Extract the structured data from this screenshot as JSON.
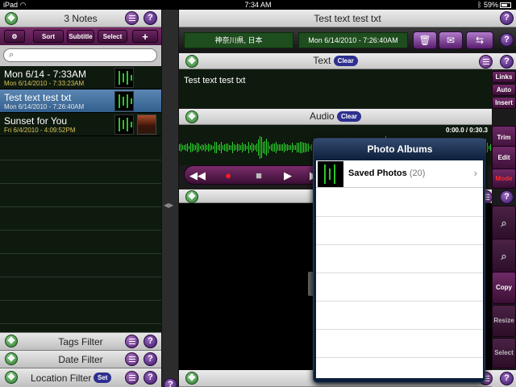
{
  "status_bar": {
    "device": "iPad",
    "time": "7:34 AM",
    "battery": "59%"
  },
  "left": {
    "header_title": "3 Notes",
    "toolbar": {
      "sort": "Sort",
      "subtitle": "Subtitle",
      "select": "Select",
      "add": "+"
    },
    "search_placeholder": "",
    "notes": [
      {
        "title": "Mon 6/14 - 7:33AM",
        "date": "Mon 6/14/2010 - 7:33:23AM",
        "thumbs": [
          "waveform"
        ],
        "selected": false
      },
      {
        "title": "Test text test txt",
        "date": "Mon 6/14/2010 - 7:26:40AM",
        "thumbs": [
          "waveform"
        ],
        "selected": true
      },
      {
        "title": "Sunset for You",
        "date": "Fri 6/4/2010 - 4:09:52PM",
        "thumbs": [
          "waveform",
          "photo"
        ],
        "selected": false
      }
    ],
    "filters": {
      "tags": "Tags Filter",
      "date": "Date Filter",
      "location": "Location Filter",
      "location_set": "Set"
    }
  },
  "divider": {
    "arrows": "◀▶"
  },
  "right": {
    "header_title": "Test text test txt",
    "location": "神奈川県, 日本",
    "date": "Mon 6/14/2010 - 7:26:40AM",
    "text_section": {
      "title": "Text",
      "clear": "Clear",
      "body": "Test text test txt"
    },
    "audio_section": {
      "title": "Audio",
      "clear": "Clear",
      "time": "0:00.0 / 0:30.3"
    },
    "side_buttons": {
      "links": "Links",
      "auto": "Auto",
      "insert": "Insert",
      "trim": "Trim",
      "edit": "Edit",
      "mode": "Mode",
      "copy": "Copy",
      "resize": "Resize",
      "select": "Select"
    }
  },
  "popover": {
    "title": "Photo Albums",
    "albums": [
      {
        "name": "Saved Photos",
        "count": "(20)"
      }
    ]
  },
  "colors": {
    "accent_maroon": "#5a1a52",
    "list_bg": "#0f1a0f",
    "selected_row": "#4a76a4",
    "waveform": "#29d629",
    "pill": "#2e2f8f"
  }
}
